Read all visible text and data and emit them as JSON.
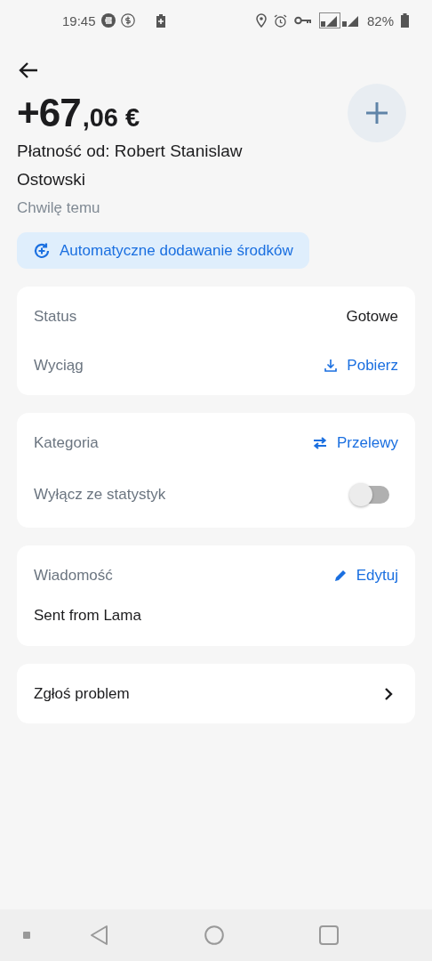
{
  "status_bar": {
    "time": "19:45",
    "battery": "82%"
  },
  "header": {
    "amount_whole": "+67",
    "amount_fraction": ",06 €",
    "title": "Płatność od: Robert Stanislaw Ostowski",
    "subtitle": "Chwilę temu",
    "chip": "Automatyczne dodawanie środków"
  },
  "cards": [
    {
      "rows": [
        {
          "kind": "value",
          "label": "Status",
          "value": "Gotowe"
        },
        {
          "kind": "download",
          "label": "Wyciąg",
          "value": "Pobierz"
        }
      ]
    },
    {
      "rows": [
        {
          "kind": "category",
          "label": "Kategoria",
          "value": "Przelewy"
        },
        {
          "kind": "toggle",
          "label": "Wyłącz ze statystyk",
          "on": false
        }
      ]
    },
    {
      "rows": [
        {
          "kind": "edit",
          "label": "Wiadomość",
          "value": "Edytuj"
        },
        {
          "kind": "message",
          "label": "Sent from Lama"
        }
      ]
    },
    {
      "rows": [
        {
          "kind": "link",
          "label": "Zgłoś problem"
        }
      ]
    }
  ]
}
